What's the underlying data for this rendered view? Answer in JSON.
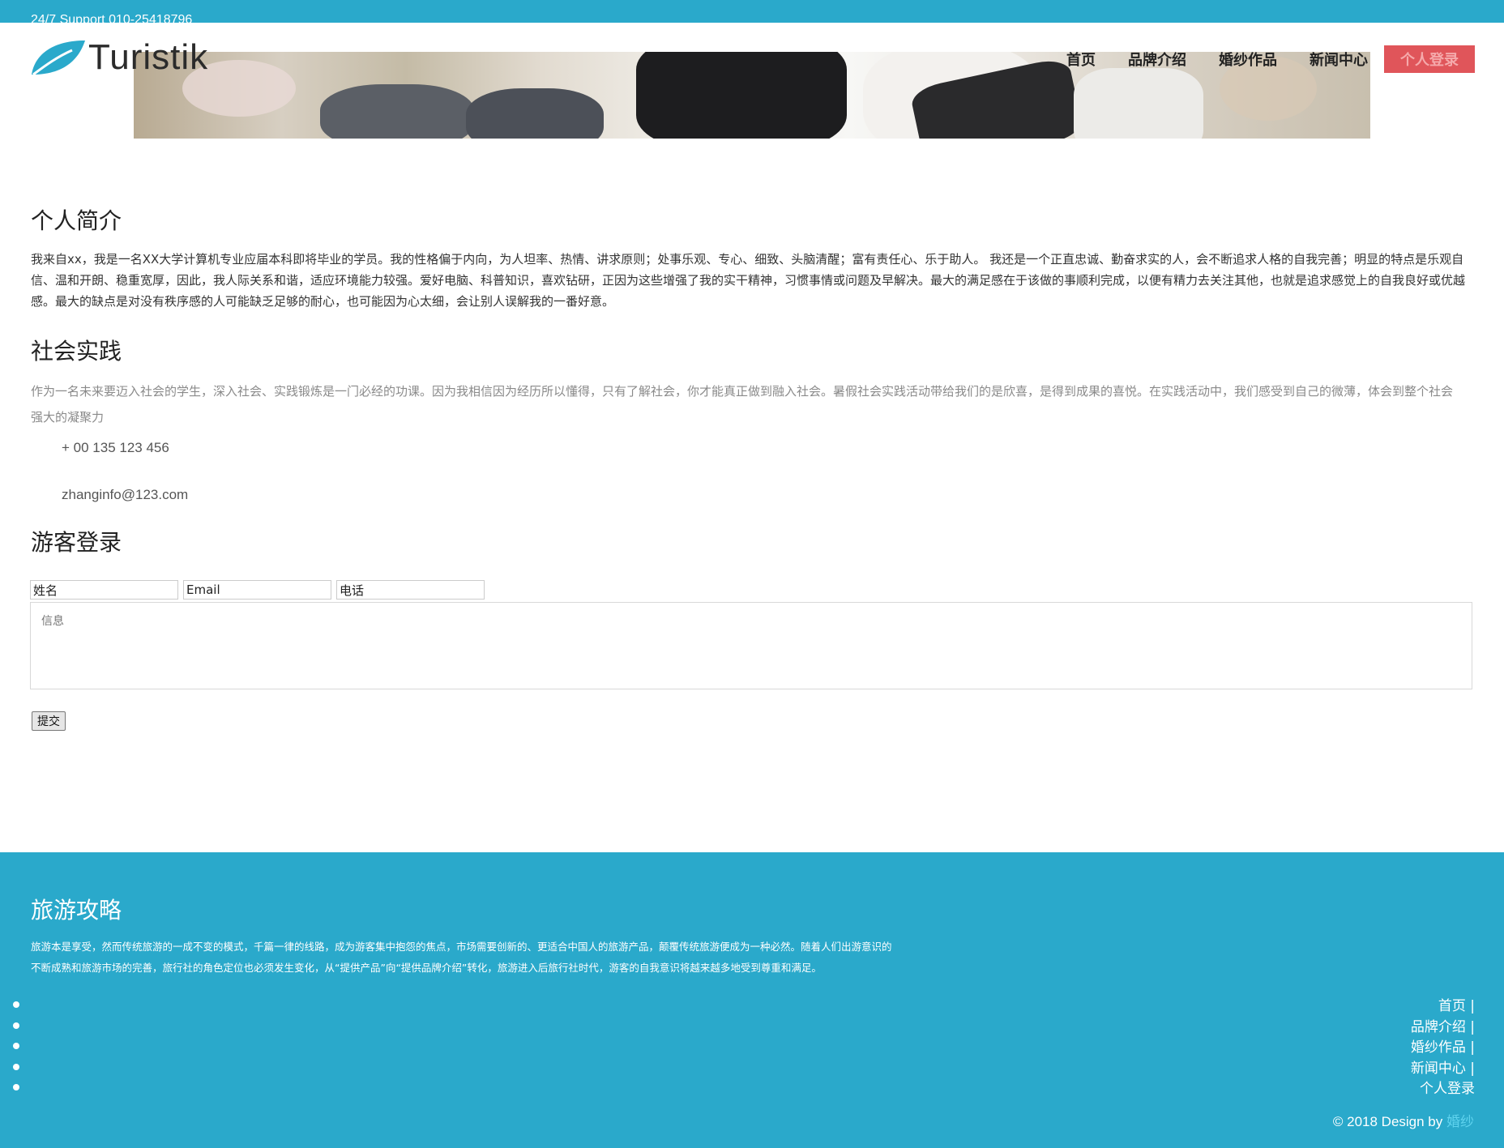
{
  "topbar": {
    "support": "24/7 Support 010-25418796"
  },
  "header": {
    "logo_text": "Turistik",
    "nav": [
      {
        "label": "首页"
      },
      {
        "label": "品牌介绍"
      },
      {
        "label": "婚纱作品"
      },
      {
        "label": "新闻中心"
      },
      {
        "label": "个人登录"
      }
    ]
  },
  "about": {
    "title": "个人简介",
    "text": "我来自xx，我是一名XX大学计算机专业应届本科即将毕业的学员。我的性格偏于内向，为人坦率、热情、讲求原则；处事乐观、专心、细致、头脑清醒；富有责任心、乐于助人。 我还是一个正直忠诚、勤奋求实的人，会不断追求人格的自我完善；明显的特点是乐观自信、温和开朗、稳重宽厚，因此，我人际关系和谐，适应环境能力较强。爱好电脑、科普知识，喜欢钻研，正因为这些增强了我的实干精神，习惯事情或问题及早解决。最大的满足感在于该做的事顺利完成，以便有精力去关注其他，也就是追求感觉上的自我良好或优越感。最大的缺点是对没有秩序感的人可能缺乏足够的耐心，也可能因为心太细，会让别人误解我的一番好意。"
  },
  "practice": {
    "title": "社会实践",
    "text": "作为一名未来要迈入社会的学生，深入社会、实践锻炼是一门必经的功课。因为我相信因为经历所以懂得，只有了解社会，你才能真正做到融入社会。暑假社会实践活动带给我们的是欣喜，是得到成果的喜悦。在实践活动中，我们感受到自己的微薄，体会到整个社会强大的凝聚力",
    "phone": "+ 00 135 123 456",
    "email": "zhanginfo@123.com"
  },
  "guest": {
    "title": "游客登录",
    "name_value": "姓名",
    "email_value": "Email",
    "phone_value": "电话",
    "message_placeholder": "信息",
    "submit_label": "提交"
  },
  "footer": {
    "title": "旅游攻略",
    "text": "旅游本是享受，然而传统旅游的一成不变的模式，千篇一律的线路，成为游客集中抱怨的焦点，市场需要创新的、更适合中国人的旅游产品，颠覆传统旅游便成为一种必然。随着人们出游意识的不断成熟和旅游市场的完善，旅行社的角色定位也必须发生变化，从“提供产品”向“提供品牌介绍”转化，旅游进入后旅行社时代，游客的自我意识将越来越多地受到尊重和满足。",
    "links": [
      {
        "label": "首页 |"
      },
      {
        "label": "品牌介绍 |"
      },
      {
        "label": "婚纱作品 |"
      },
      {
        "label": "新闻中心 |"
      },
      {
        "label": "个人登录"
      }
    ],
    "copyright_prefix": "© 2018 Design by",
    "designer": "婚纱"
  },
  "colors": {
    "primary": "#2aa9cb",
    "login_button": "#e0555a",
    "designer_link": "#5fd3ee"
  }
}
